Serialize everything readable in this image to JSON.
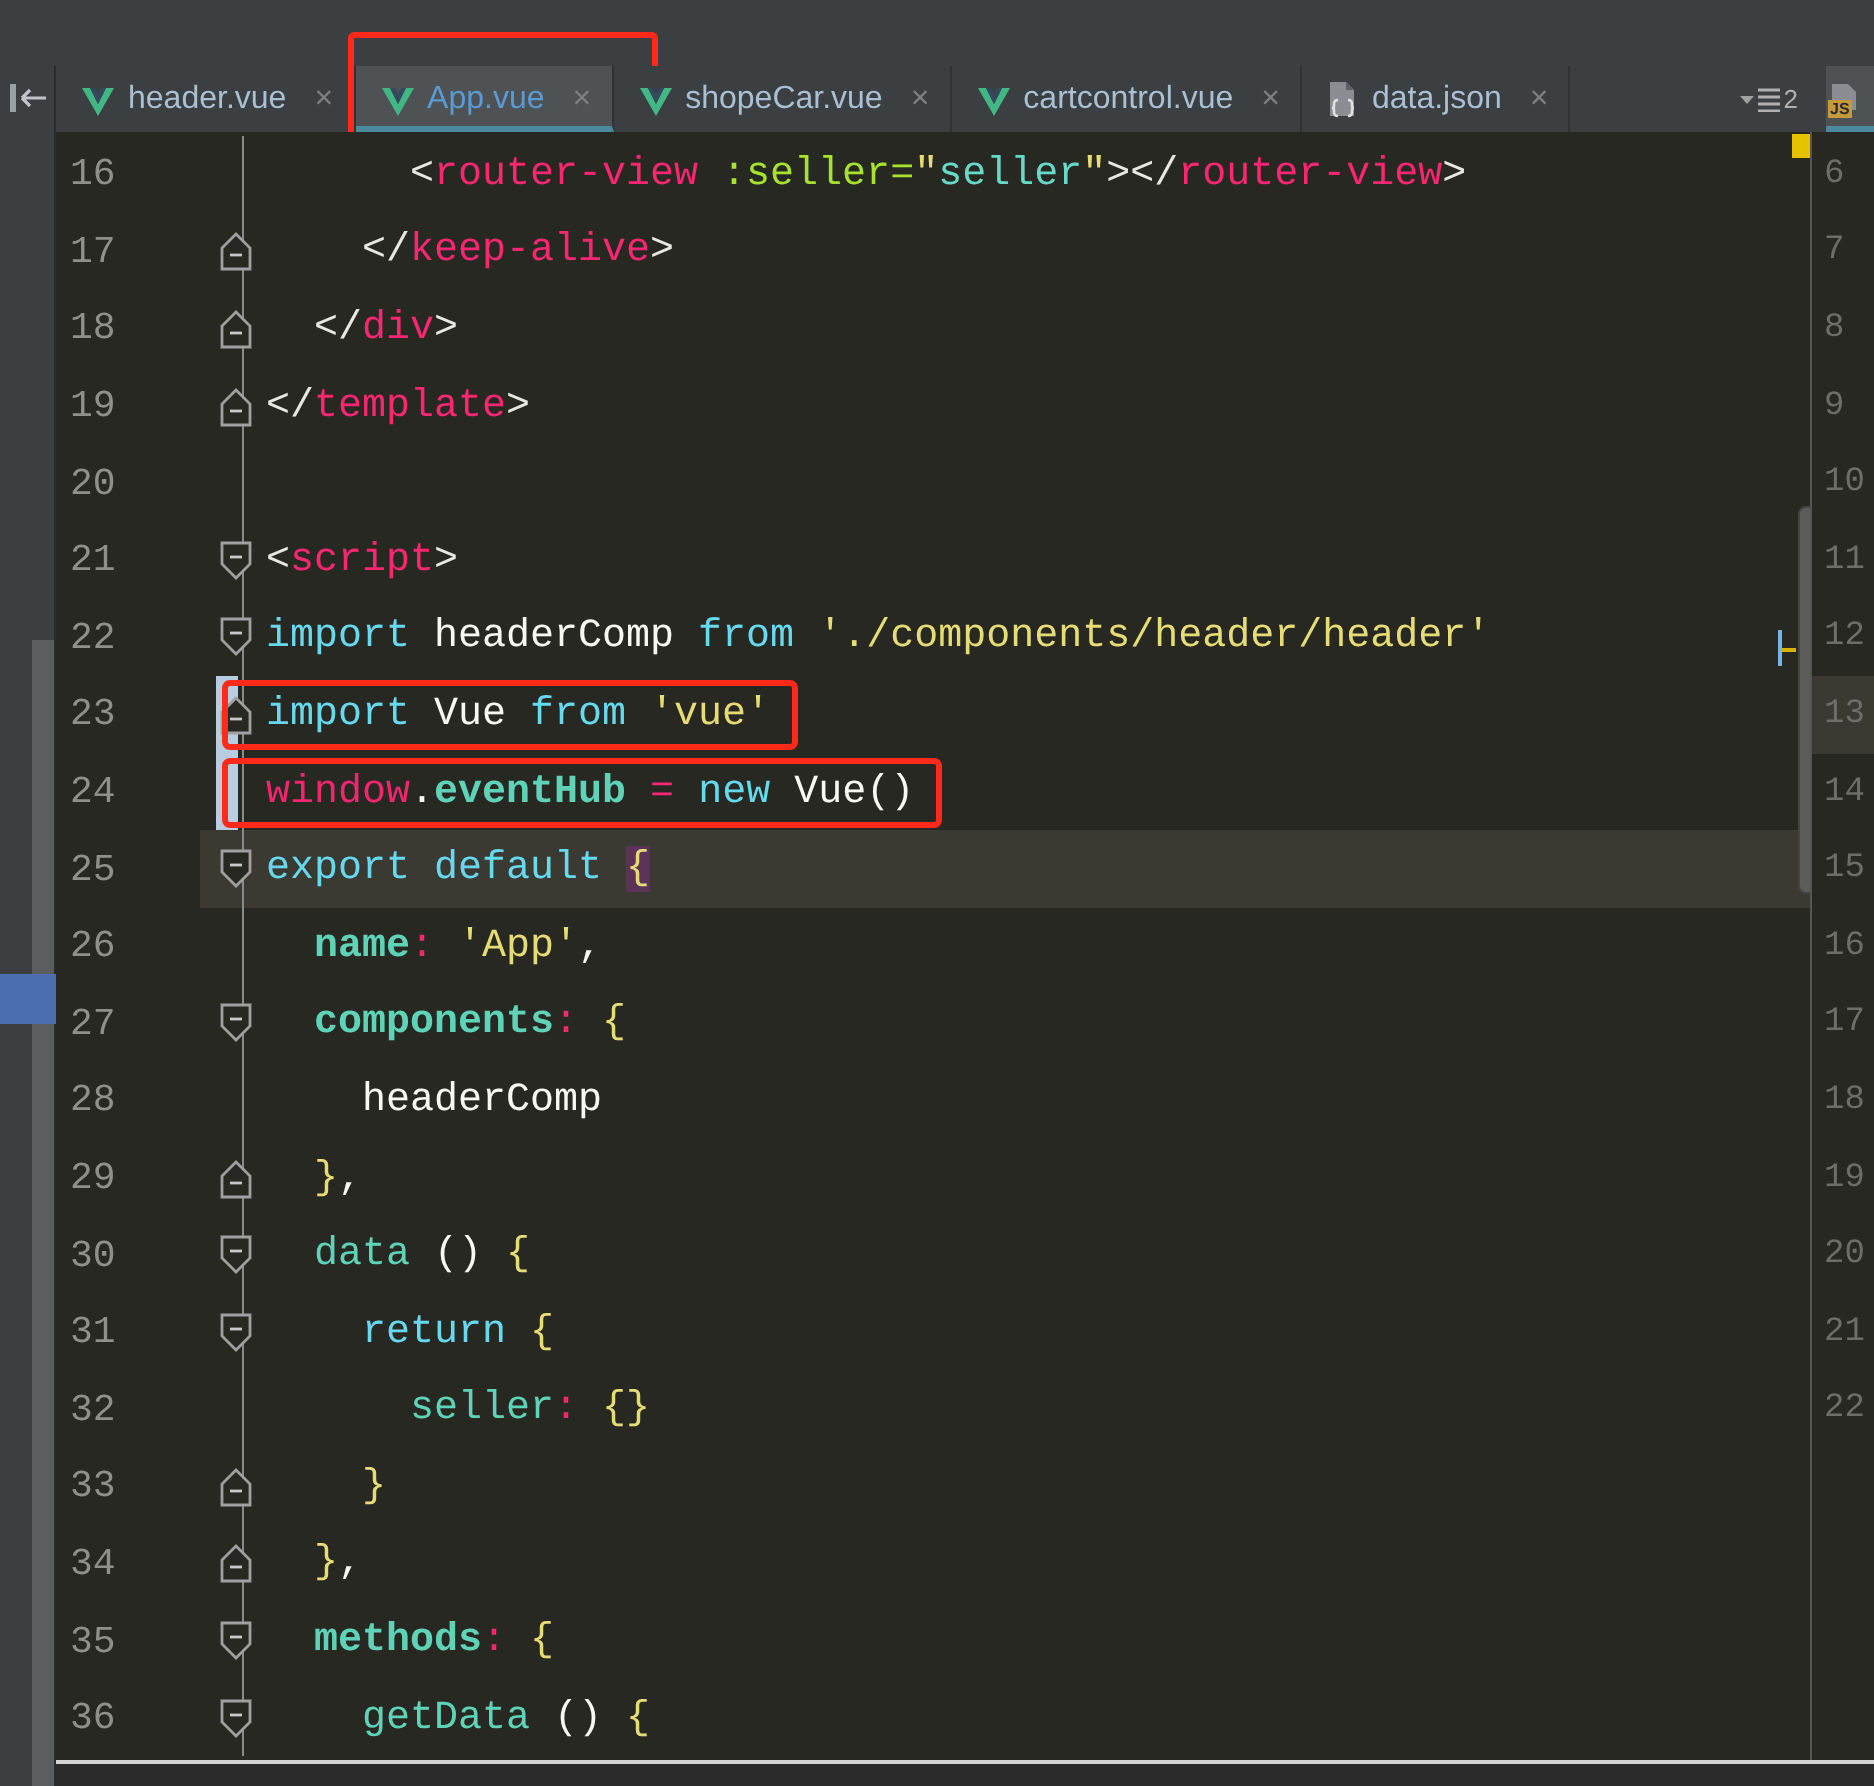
{
  "tabs": [
    {
      "label": "header.vue",
      "kind": "vue",
      "close": "×",
      "selected": false,
      "annotated": false
    },
    {
      "label": "App.vue",
      "kind": "vue",
      "close": "×",
      "selected": true,
      "annotated": true
    },
    {
      "label": "shopeCar.vue",
      "kind": "vue",
      "close": "×",
      "selected": false,
      "annotated": false
    },
    {
      "label": "cartcontrol.vue",
      "kind": "vue",
      "close": "×",
      "selected": false,
      "annotated": false
    },
    {
      "label": "data.json",
      "kind": "json",
      "close": "×",
      "selected": false,
      "annotated": false
    }
  ],
  "tab_overflow": {
    "count": "2"
  },
  "editor": {
    "lines": [
      {
        "number": "16",
        "kind": "plain",
        "current": false,
        "changed": false,
        "annotated": false,
        "tokens": [
          {
            "text": "      <",
            "kind": "punct"
          },
          {
            "text": "router-view",
            "kind": "tag"
          },
          {
            "text": " :seller=",
            "kind": "attr"
          },
          {
            "text": "\"",
            "kind": "string"
          },
          {
            "text": "seller",
            "kind": "value"
          },
          {
            "text": "\"",
            "kind": "string"
          },
          {
            "text": "></",
            "kind": "punct"
          },
          {
            "text": "router-view",
            "kind": "tag"
          },
          {
            "text": ">",
            "kind": "punct"
          }
        ]
      },
      {
        "number": "17",
        "kind": "fold-end",
        "current": false,
        "changed": false,
        "annotated": false,
        "tokens": [
          {
            "text": "    </",
            "kind": "punct"
          },
          {
            "text": "keep-alive",
            "kind": "tag"
          },
          {
            "text": ">",
            "kind": "punct"
          }
        ]
      },
      {
        "number": "18",
        "kind": "fold-end",
        "current": false,
        "changed": false,
        "annotated": false,
        "tokens": [
          {
            "text": "  </",
            "kind": "punct"
          },
          {
            "text": "div",
            "kind": "tag"
          },
          {
            "text": ">",
            "kind": "punct"
          }
        ]
      },
      {
        "number": "19",
        "kind": "fold-end",
        "current": false,
        "changed": false,
        "annotated": false,
        "tokens": [
          {
            "text": "</",
            "kind": "punct"
          },
          {
            "text": "template",
            "kind": "tag"
          },
          {
            "text": ">",
            "kind": "punct"
          }
        ]
      },
      {
        "number": "20",
        "kind": "plain",
        "current": false,
        "changed": false,
        "annotated": false
      },
      {
        "number": "21",
        "kind": "fold-start",
        "current": false,
        "changed": false,
        "annotated": false,
        "tokens": [
          {
            "text": "<",
            "kind": "punct"
          },
          {
            "text": "script",
            "kind": "tag"
          },
          {
            "text": ">",
            "kind": "punct"
          }
        ]
      },
      {
        "number": "22",
        "kind": "fold-start",
        "current": false,
        "changed": false,
        "annotated": false,
        "tokens": [
          {
            "text": "import",
            "kind": "keyword"
          },
          {
            "text": " headerComp ",
            "kind": "plain"
          },
          {
            "text": "from",
            "kind": "keyword"
          },
          {
            "text": " './components/header/header'",
            "kind": "string"
          }
        ]
      },
      {
        "number": "23",
        "kind": "fold-end",
        "current": false,
        "changed": true,
        "annotated": true,
        "tokens": [
          {
            "text": "import",
            "kind": "keyword"
          },
          {
            "text": " Vue ",
            "kind": "plain"
          },
          {
            "text": "from",
            "kind": "keyword"
          },
          {
            "text": " 'vue'",
            "kind": "string"
          }
        ]
      },
      {
        "number": "24",
        "kind": "plain",
        "current": false,
        "changed": true,
        "annotated": true,
        "tokens": [
          {
            "text": "window",
            "kind": "global"
          },
          {
            "text": ".",
            "kind": "plain"
          },
          {
            "text": "eventHub",
            "kind": "property"
          },
          {
            "text": " = ",
            "kind": "operator"
          },
          {
            "text": "new",
            "kind": "keyword"
          },
          {
            "text": " Vue()",
            "kind": "plain"
          }
        ]
      },
      {
        "number": "25",
        "kind": "fold-start",
        "current": true,
        "changed": false,
        "annotated": false,
        "tokens": [
          {
            "text": "export default ",
            "kind": "keyword"
          },
          {
            "text": "{",
            "kind": "brace-match"
          }
        ]
      },
      {
        "number": "26",
        "kind": "plain",
        "current": false,
        "changed": false,
        "annotated": false,
        "tokens": [
          {
            "text": "  name",
            "kind": "property"
          },
          {
            "text": ":",
            "kind": "operator"
          },
          {
            "text": " 'App'",
            "kind": "string"
          },
          {
            "text": ",",
            "kind": "plain"
          }
        ]
      },
      {
        "number": "27",
        "kind": "fold-start",
        "current": false,
        "changed": false,
        "annotated": false,
        "tokens": [
          {
            "text": "  components",
            "kind": "property"
          },
          {
            "text": ":",
            "kind": "operator"
          },
          {
            "text": " {",
            "kind": "brace"
          }
        ]
      },
      {
        "number": "28",
        "kind": "plain",
        "current": false,
        "changed": false,
        "annotated": false,
        "tokens": [
          {
            "text": "    headerComp",
            "kind": "plain"
          }
        ]
      },
      {
        "number": "29",
        "kind": "fold-end",
        "current": false,
        "changed": false,
        "annotated": false,
        "tokens": [
          {
            "text": "  }",
            "kind": "brace"
          },
          {
            "text": ",",
            "kind": "plain"
          }
        ]
      },
      {
        "number": "30",
        "kind": "fold-start",
        "current": false,
        "changed": false,
        "annotated": false,
        "tokens": [
          {
            "text": "  data",
            "kind": "method"
          },
          {
            "text": " () ",
            "kind": "plain"
          },
          {
            "text": "{",
            "kind": "brace"
          }
        ]
      },
      {
        "number": "31",
        "kind": "fold-start",
        "current": false,
        "changed": false,
        "annotated": false,
        "tokens": [
          {
            "text": "    return",
            "kind": "keyword"
          },
          {
            "text": " {",
            "kind": "brace"
          }
        ]
      },
      {
        "number": "32",
        "kind": "plain",
        "current": false,
        "changed": false,
        "annotated": false,
        "tokens": [
          {
            "text": "      seller",
            "kind": "method"
          },
          {
            "text": ":",
            "kind": "operator"
          },
          {
            "text": " {}",
            "kind": "brace"
          }
        ]
      },
      {
        "number": "33",
        "kind": "fold-end",
        "current": false,
        "changed": false,
        "annotated": false,
        "tokens": [
          {
            "text": "    }",
            "kind": "brace"
          }
        ]
      },
      {
        "number": "34",
        "kind": "fold-end",
        "current": false,
        "changed": false,
        "annotated": false,
        "tokens": [
          {
            "text": "  }",
            "kind": "brace"
          },
          {
            "text": ",",
            "kind": "plain"
          }
        ]
      },
      {
        "number": "35",
        "kind": "fold-start",
        "current": false,
        "changed": false,
        "annotated": false,
        "tokens": [
          {
            "text": "  methods",
            "kind": "property"
          },
          {
            "text": ":",
            "kind": "operator"
          },
          {
            "text": " {",
            "kind": "brace"
          }
        ]
      },
      {
        "number": "36",
        "kind": "fold-start",
        "current": false,
        "changed": false,
        "annotated": false,
        "tokens": [
          {
            "text": "    getData",
            "kind": "method"
          },
          {
            "text": " () ",
            "kind": "plain"
          },
          {
            "text": "{",
            "kind": "brace"
          }
        ]
      }
    ]
  },
  "side_editor": {
    "tab": {
      "badge": "JS"
    },
    "lines": [
      {
        "number": "6",
        "current": false
      },
      {
        "number": "7",
        "current": false
      },
      {
        "number": "8",
        "current": false
      },
      {
        "number": "9",
        "current": false
      },
      {
        "number": "10",
        "current": false
      },
      {
        "number": "11",
        "current": false
      },
      {
        "number": "12",
        "current": false
      },
      {
        "number": "13",
        "current": true
      },
      {
        "number": "14",
        "current": false
      },
      {
        "number": "15",
        "current": false
      },
      {
        "number": "16",
        "current": false
      },
      {
        "number": "17",
        "current": false
      },
      {
        "number": "18",
        "current": false
      },
      {
        "number": "19",
        "current": false
      },
      {
        "number": "20",
        "current": false
      },
      {
        "number": "21",
        "current": false
      },
      {
        "number": "22",
        "current": false
      }
    ]
  }
}
